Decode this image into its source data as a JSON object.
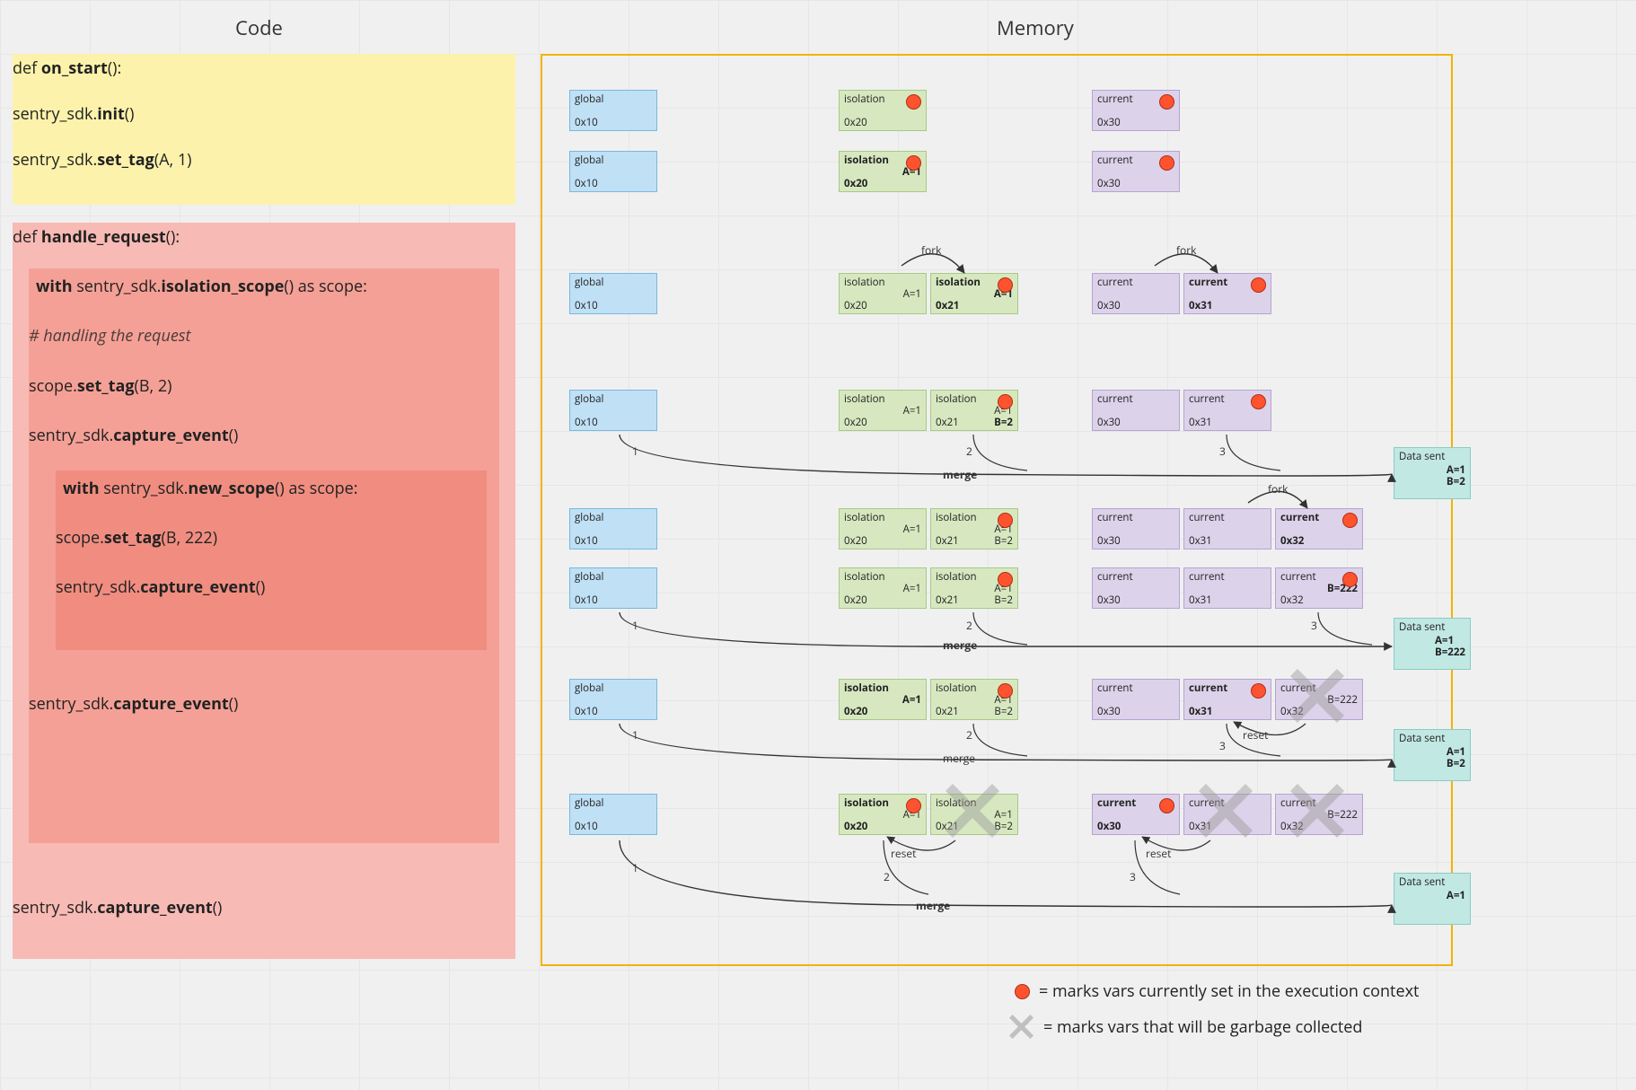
{
  "titles": {
    "code": "Code",
    "memory": "Memory"
  },
  "code": {
    "on_start_sig": "def on_start():",
    "init": "sentry_sdk.init()",
    "set_tag_a": "sentry_sdk.set_tag(A, 1)",
    "handle_sig": "def handle_request():",
    "with_iso": "with sentry_sdk.isolation_scope() as scope:",
    "comment": "# handling the request",
    "set_tag_b": "scope.set_tag(B, 2)",
    "capture1": "sentry_sdk.capture_event()",
    "with_new": "with sentry_sdk.new_scope() as scope:",
    "set_tag_b222": "scope.set_tag(B, 222)",
    "capture2": "sentry_sdk.capture_event()",
    "capture3": "sentry_sdk.capture_event()",
    "capture4": "sentry_sdk.capture_event()"
  },
  "labels": {
    "global": "global",
    "isolation": "isolation",
    "current": "current",
    "data_sent": "Data sent",
    "fork": "fork",
    "merge": "merge",
    "reset": "reset",
    "one": "1",
    "two": "2",
    "three": "3"
  },
  "addr": {
    "g": "0x10",
    "i0": "0x20",
    "i1": "0x21",
    "c0": "0x30",
    "c1": "0x31",
    "c2": "0x32"
  },
  "vals": {
    "a1": "A=1",
    "b2": "B=2",
    "a1b2": "A=1\nB=2",
    "b222": "B=222",
    "sent1": "A=1\nB=2",
    "sent2": "A=1\nB=222",
    "sent3": "A=1\nB=2",
    "sent4": "A=1"
  },
  "legend": {
    "red": "= marks vars currently set in the execution context",
    "gc": "= marks vars that will be garbage collected"
  }
}
